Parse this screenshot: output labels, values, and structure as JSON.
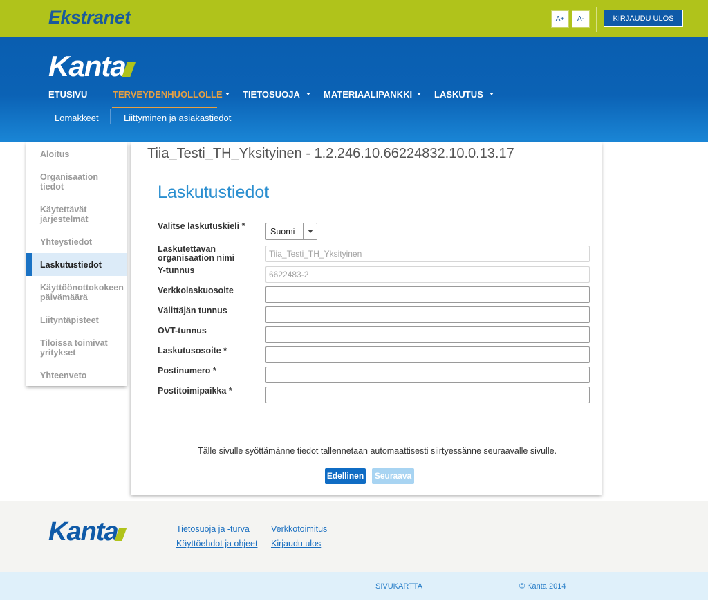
{
  "topbar": {
    "brand": "Ekstranet",
    "font_larger": "A+",
    "font_smaller": "A-",
    "logout": "KIRJAUDU ULOS",
    "color": "#b0c31b"
  },
  "header": {
    "logo": "Kanta",
    "nav": [
      {
        "label": "ETUSIVU"
      },
      {
        "label": "TERVEYDENHUOLLOLLE"
      },
      {
        "label": "TIETOSUOJA"
      },
      {
        "label": "MATERIAALIPANKKI"
      },
      {
        "label": "LASKUTUS"
      }
    ],
    "subnav": [
      {
        "label": "Lomakkeet"
      },
      {
        "label": "Liittyminen ja asiakastiedot"
      }
    ],
    "color": "#0b62b5",
    "active_color": "#e8a040"
  },
  "sidebar": {
    "items": [
      {
        "label": "Aloitus"
      },
      {
        "label": "Organisaation tiedot"
      },
      {
        "label": "Käytettävät järjestelmät"
      },
      {
        "label": "Yhteystiedot"
      },
      {
        "label": "Laskutustiedot"
      },
      {
        "label": "Käyttöönottokokeen päivämäärä"
      },
      {
        "label": "Liityntäpisteet"
      },
      {
        "label": "Tiloissa toimivat yritykset"
      },
      {
        "label": "Yhteenveto"
      }
    ],
    "active_index": 4
  },
  "main": {
    "org_title": "Tiia_Testi_TH_Yksityinen - 1.2.246.10.66224832.10.0.13.17",
    "section_title": "Laskutustiedot",
    "form": {
      "language_label": "Valitse laskutuskieli *",
      "language_value": "Suomi",
      "org_name_label": "Laskutettavan organisaation nimi",
      "org_name_value": "Tiia_Testi_TH_Yksityinen",
      "ytunnus_label": "Y-tunnus",
      "ytunnus_value": "6622483-2",
      "e_invoice_label": "Verkkolaskuosoite",
      "operator_label": "Välittäjän tunnus",
      "ovt_label": "OVT-tunnus",
      "billing_address_label": "Laskutusosoite *",
      "postal_code_label": "Postinumero *",
      "city_label": "Postitoimipaikka *"
    },
    "info_text": "Tälle sivulle syöttämänne tiedot tallennetaan automaattisesti siirtyessänne seuraavalle sivulle.",
    "prev_button": "Edellinen",
    "next_button": "Seuraava",
    "accent_color": "#2b8fd0"
  },
  "footer": {
    "logo": "Kanta",
    "links": [
      {
        "label": "Tietosuoja ja -turva"
      },
      {
        "label": "Käyttöehdot ja ohjeet"
      },
      {
        "label": "Verkkotoimitus"
      },
      {
        "label": "Kirjaudu ulos"
      }
    ],
    "sitemap": "SIVUKARTTA",
    "copyright": "© Kanta 2014"
  }
}
